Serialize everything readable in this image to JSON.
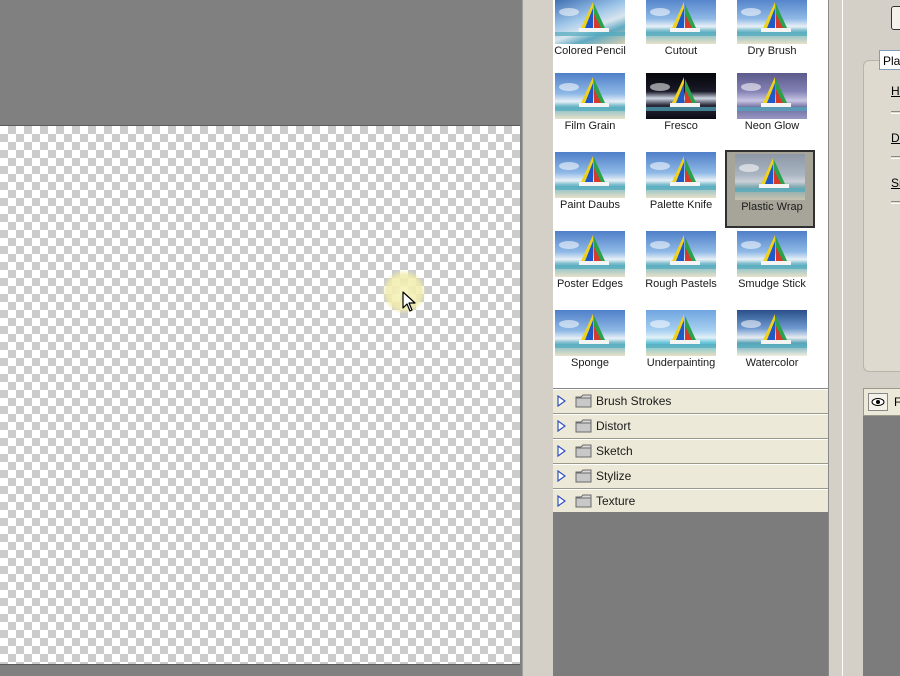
{
  "filters": [
    {
      "label": "Colored Pencil",
      "effect": "colored",
      "selected": false
    },
    {
      "label": "Cutout",
      "effect": "normal",
      "selected": false
    },
    {
      "label": "Dry Brush",
      "effect": "normal",
      "selected": false
    },
    {
      "label": "Film Grain",
      "effect": "normal",
      "selected": false
    },
    {
      "label": "Fresco",
      "effect": "fresco",
      "selected": false
    },
    {
      "label": "Neon Glow",
      "effect": "neon",
      "selected": false
    },
    {
      "label": "Paint Daubs",
      "effect": "normal",
      "selected": false
    },
    {
      "label": "Palette Knife",
      "effect": "normal",
      "selected": false
    },
    {
      "label": "Plastic Wrap",
      "effect": "plastic",
      "selected": true
    },
    {
      "label": "Poster Edges",
      "effect": "normal",
      "selected": false
    },
    {
      "label": "Rough Pastels",
      "effect": "normal",
      "selected": false
    },
    {
      "label": "Smudge Stick",
      "effect": "normal",
      "selected": false
    },
    {
      "label": "Sponge",
      "effect": "normal",
      "selected": false
    },
    {
      "label": "Underpainting",
      "effect": "under",
      "selected": false
    },
    {
      "label": "Watercolor",
      "effect": "water",
      "selected": false
    }
  ],
  "categories": [
    {
      "label": "Brush Strokes"
    },
    {
      "label": "Distort"
    },
    {
      "label": "Sketch"
    },
    {
      "label": "Stylize"
    },
    {
      "label": "Texture"
    }
  ],
  "settings": {
    "filter_select_value": "Plas",
    "slider_1_label": "Hi",
    "slider_2_label": "De",
    "slider_3_label": "Sn"
  },
  "layers": {
    "header_partial": "F"
  },
  "icons": {
    "category_arrow": "triangle-right-icon",
    "category_folder": "folder-icon",
    "cursor": "mouse-pointer-icon",
    "visibility": "eye-icon"
  },
  "colors": {
    "panel_bg": "#d4d0c8",
    "category_bg": "#ece9d8",
    "selected_thumb_bg": "#a7a59a",
    "workspace_gray": "#808080"
  }
}
